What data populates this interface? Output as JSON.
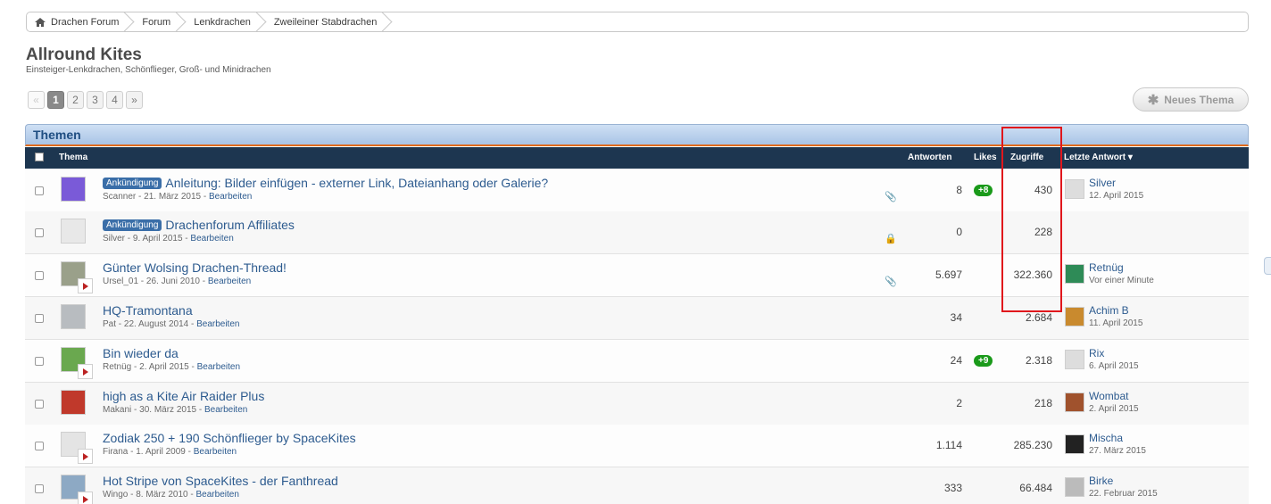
{
  "breadcrumb": [
    "Drachen Forum",
    "Forum",
    "Lenkdrachen",
    "Zweileiner Stabdrachen"
  ],
  "forum": {
    "title": "Allround Kites",
    "description": "Einsteiger-Lenkdrachen, Schönflieger, Groß- und Minidrachen"
  },
  "pagination": {
    "prev": "«",
    "pages": [
      "1",
      "2",
      "3",
      "4"
    ],
    "next": "»",
    "current": "1"
  },
  "new_thread_label": "Neues Thema",
  "section_title": "Themen",
  "columns": {
    "thema": "Thema",
    "antworten": "Antworten",
    "likes": "Likes",
    "zugriffe": "Zugriffe",
    "letzte": "Letzte Antwort ▾"
  },
  "threads": [
    {
      "prefix": "Ankündigung",
      "title": "Anleitung: Bilder einfügen - externer Link, Dateianhang oder Galerie?",
      "author": "Scanner",
      "date": "21. März 2015",
      "edit": "Bearbeiten",
      "icon": "📎",
      "replies": "8",
      "likes": "+8",
      "views": "430",
      "last_user": "Silver",
      "last_date": "12. April 2015"
    },
    {
      "prefix": "Ankündigung",
      "title": "Drachenforum Affiliates",
      "author": "Silver",
      "date": "9. April 2015",
      "edit": "Bearbeiten",
      "icon": "🔒",
      "replies": "0",
      "likes": "",
      "views": "228",
      "last_user": "",
      "last_date": ""
    },
    {
      "prefix": "",
      "title": "Günter Wolsing Drachen-Thread!",
      "author": "Ursel_01",
      "date": "26. Juni 2010",
      "edit": "Bearbeiten",
      "icon": "📎",
      "replies": "5.697",
      "likes": "",
      "views": "322.360",
      "last_user": "Retnüg",
      "last_date": "Vor einer Minute"
    },
    {
      "prefix": "",
      "title": "HQ-Tramontana",
      "author": "Pat",
      "date": "22. August 2014",
      "edit": "Bearbeiten",
      "icon": "",
      "replies": "34",
      "likes": "",
      "views": "2.684",
      "last_user": "Achim B",
      "last_date": "11. April 2015"
    },
    {
      "prefix": "",
      "title": "Bin wieder da",
      "author": "Retnüg",
      "date": "2. April 2015",
      "edit": "Bearbeiten",
      "icon": "",
      "replies": "24",
      "likes": "+9",
      "views": "2.318",
      "last_user": "Rix",
      "last_date": "6. April 2015"
    },
    {
      "prefix": "",
      "title": "high as a Kite Air Raider Plus",
      "author": "Makani",
      "date": "30. März 2015",
      "edit": "Bearbeiten",
      "icon": "",
      "replies": "2",
      "likes": "",
      "views": "218",
      "last_user": "Wombat",
      "last_date": "2. April 2015"
    },
    {
      "prefix": "",
      "title": "Zodiak 250 + 190 Schönflieger by SpaceKites",
      "author": "Firana",
      "date": "1. April 2009",
      "edit": "Bearbeiten",
      "icon": "",
      "replies": "1.114",
      "likes": "",
      "views": "285.230",
      "last_user": "Mischa",
      "last_date": "27. März 2015"
    },
    {
      "prefix": "",
      "title": "Hot Stripe von SpaceKites - der Fanthread",
      "author": "Wingo",
      "date": "8. März 2010",
      "edit": "Bearbeiten",
      "icon": "",
      "replies": "333",
      "likes": "",
      "views": "66.484",
      "last_user": "Birke",
      "last_date": "22. Februar 2015"
    }
  ],
  "colors": {
    "accent": "#2d5b8f",
    "header_bar": "#1d3650",
    "likes_green": "#1a9a1a",
    "highlight": "#e0161c"
  }
}
